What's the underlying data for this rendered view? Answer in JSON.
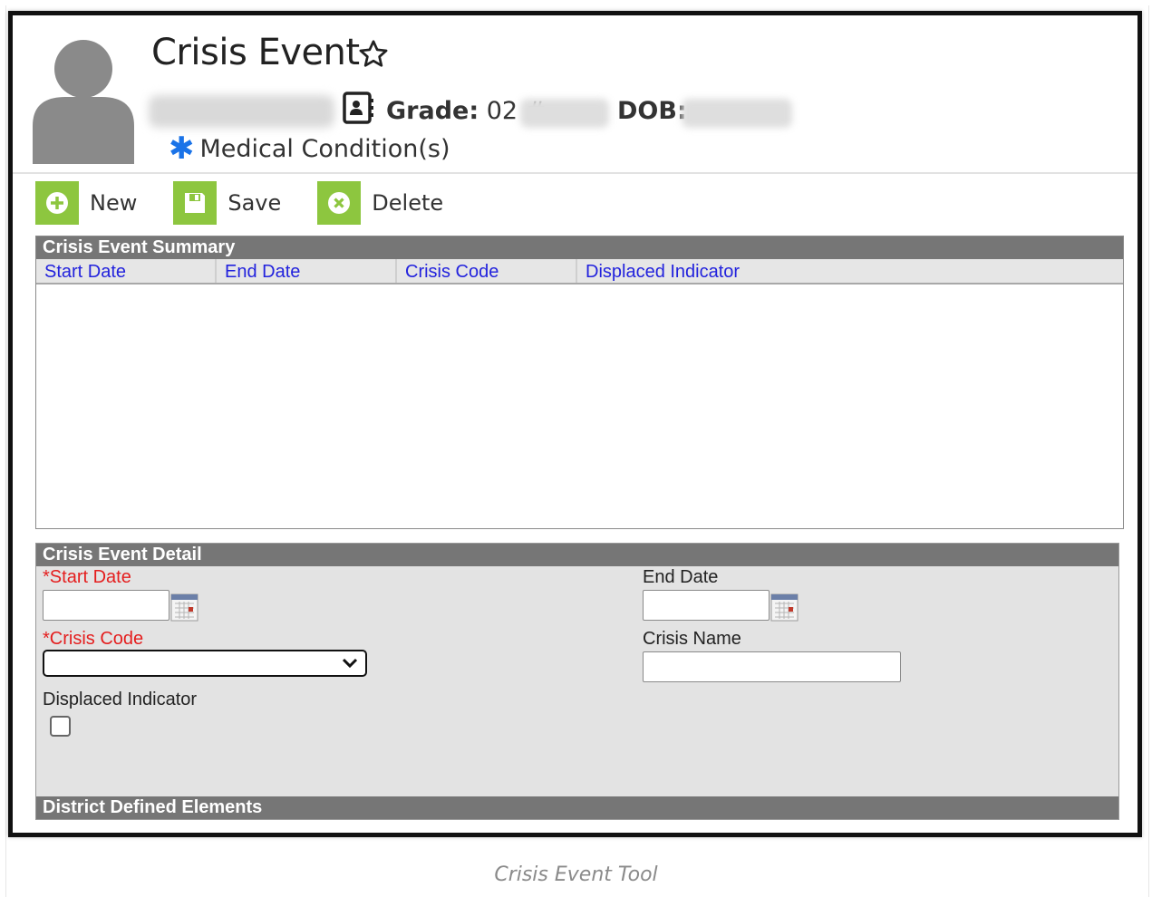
{
  "header": {
    "title": "Crisis Event",
    "grade_label": "Grade:",
    "grade_value": "02",
    "id_prefix": "#",
    "dob_label": "DOB:",
    "medical_label": "Medical Condition(s)"
  },
  "toolbar": {
    "new_label": "New",
    "save_label": "Save",
    "delete_label": "Delete"
  },
  "summary": {
    "title": "Crisis Event Summary",
    "columns": [
      "Start Date",
      "End Date",
      "Crisis Code",
      "Displaced Indicator"
    ],
    "rows": []
  },
  "detail": {
    "title": "Crisis Event Detail",
    "required_mark": "*",
    "start_date_label": "Start Date",
    "start_date_value": "",
    "end_date_label": "End Date",
    "end_date_value": "",
    "crisis_code_label": "Crisis Code",
    "crisis_code_value": "",
    "crisis_name_label": "Crisis Name",
    "crisis_name_value": "",
    "displaced_label": "Displaced Indicator",
    "displaced_checked": false,
    "district_title": "District Defined Elements"
  },
  "caption": "Crisis Event Tool",
  "colors": {
    "accent_green": "#8dc63f",
    "section_bar": "#767676",
    "link_blue": "#2222dd",
    "required_red": "#e41e1e",
    "medical_blue": "#1a73e8"
  },
  "icons": [
    "user-avatar-icon",
    "star-icon",
    "contact-card-icon",
    "asterisk-icon",
    "add-icon",
    "save-icon",
    "delete-icon",
    "calendar-icon",
    "chevron-down-icon"
  ]
}
